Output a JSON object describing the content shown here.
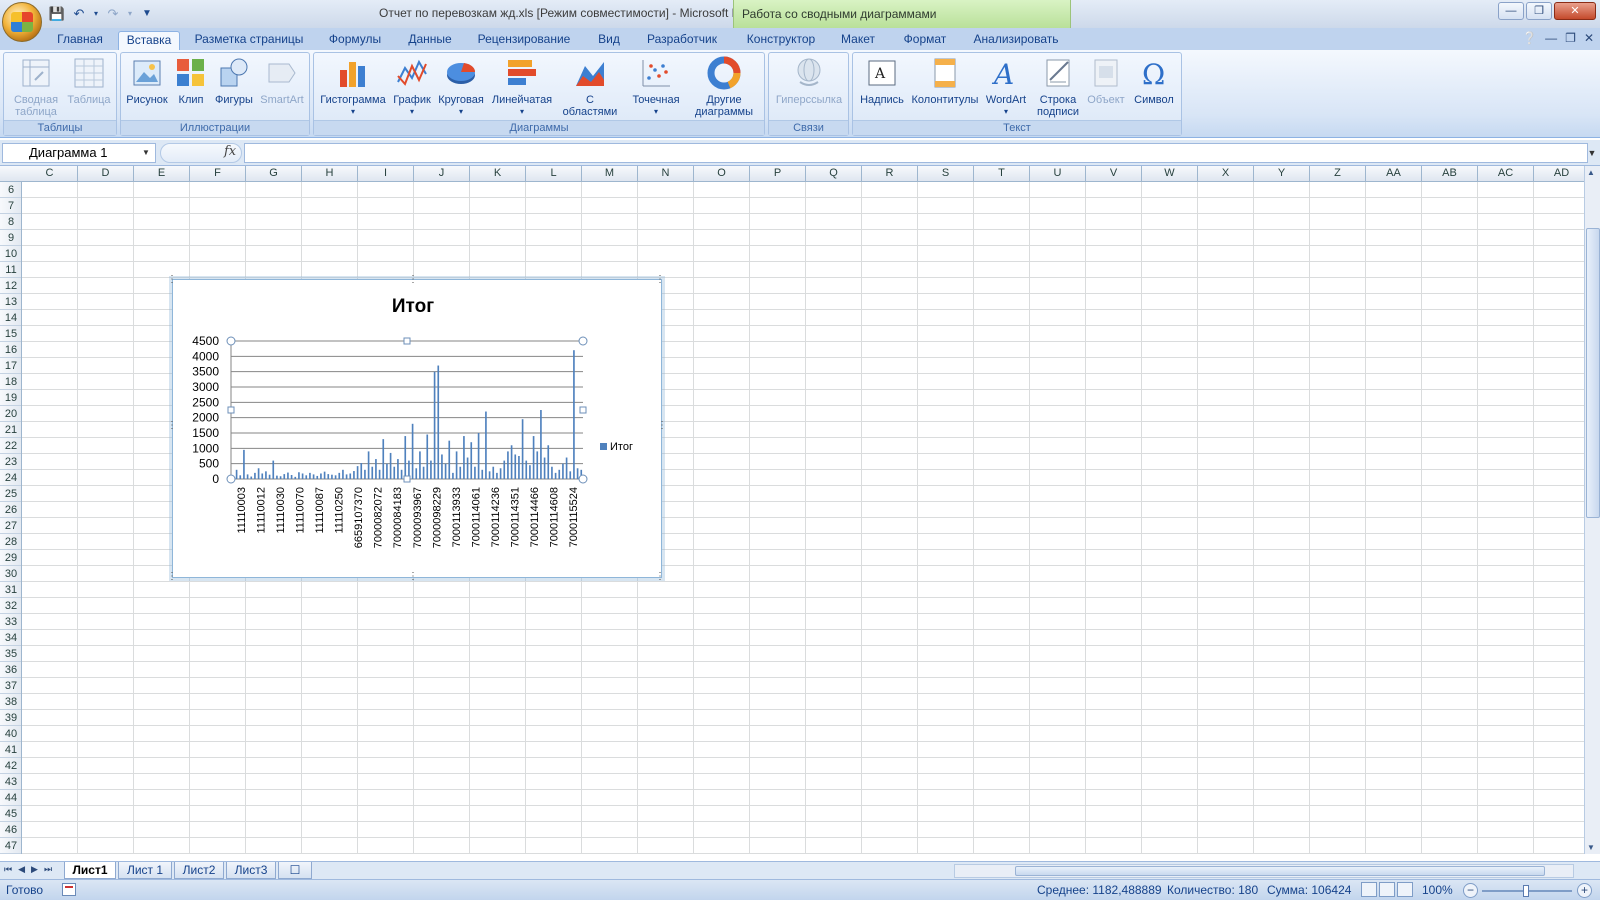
{
  "titlebar": {
    "window_title": "Отчет по перевозкам жд.xls  [Режим совместимости] - Microsoft Excel",
    "contextual_title": "Работа со сводными диаграммами"
  },
  "tabs": [
    {
      "label": "Главная"
    },
    {
      "label": "Вставка",
      "active": true
    },
    {
      "label": "Разметка страницы"
    },
    {
      "label": "Формулы"
    },
    {
      "label": "Данные"
    },
    {
      "label": "Рецензирование"
    },
    {
      "label": "Вид"
    },
    {
      "label": "Разработчик"
    },
    {
      "label": "Конструктор"
    },
    {
      "label": "Макет"
    },
    {
      "label": "Формат"
    },
    {
      "label": "Анализировать"
    }
  ],
  "ribbon": {
    "groups": {
      "tables": "Таблицы",
      "illustrations": "Иллюстрации",
      "charts": "Диаграммы",
      "links": "Связи",
      "text": "Текст"
    },
    "buttons": {
      "pivot_table_1": "Сводная",
      "pivot_table_2": "таблица",
      "table": "Таблица",
      "picture": "Рисунок",
      "clip": "Клип",
      "shapes": "Фигуры",
      "smartart": "SmartArt",
      "histogram": "Гистограмма",
      "line": "График",
      "pie": "Круговая",
      "bar": "Линейчатая",
      "area_1": "С",
      "area_2": "областями",
      "scatter": "Точечная",
      "other_1": "Другие",
      "other_2": "диаграммы",
      "hyperlink": "Гиперссылка",
      "textbox": "Надпись",
      "header_footer": "Колонтитулы",
      "wordart": "WordArt",
      "signature_1": "Строка",
      "signature_2": "подписи",
      "object": "Объект",
      "symbol": "Символ"
    }
  },
  "formula_bar": {
    "name_box": "Диаграмма 1",
    "fx": "fx",
    "value": ""
  },
  "grid": {
    "columns": [
      "C",
      "D",
      "E",
      "F",
      "G",
      "H",
      "I",
      "J",
      "K",
      "L",
      "M",
      "N",
      "O",
      "P",
      "Q",
      "R",
      "S",
      "T",
      "U",
      "V",
      "W",
      "X",
      "Y",
      "Z",
      "AA",
      "AB",
      "AC",
      "AD"
    ],
    "rows": [
      "6",
      "7",
      "8",
      "9",
      "10",
      "11",
      "12",
      "13",
      "14",
      "15",
      "16",
      "17",
      "18",
      "19",
      "20",
      "21",
      "22",
      "23",
      "24",
      "25",
      "26",
      "27",
      "28",
      "29",
      "30",
      "31",
      "32",
      "33",
      "34",
      "35",
      "36",
      "37",
      "38",
      "39",
      "40",
      "41",
      "42",
      "43",
      "44",
      "45",
      "46",
      "47"
    ]
  },
  "chart_data": {
    "type": "bar",
    "title": "Итог",
    "legend": {
      "entry": "Итог",
      "position": "right"
    },
    "color": "#4f81bd",
    "ylim": [
      0,
      4500
    ],
    "yticks": [
      0,
      500,
      1000,
      1500,
      2000,
      2500,
      3000,
      3500,
      4000,
      4500
    ],
    "xtick_labels": [
      "11110003",
      "11110012",
      "11110030",
      "11110070",
      "11110087",
      "11110250",
      "6659107370",
      "7000082072",
      "7000084183",
      "7000093967",
      "7000098229",
      "7000113933",
      "7000114061",
      "7000114236",
      "7000114351",
      "7000114466",
      "7000114608",
      "7000115524"
    ],
    "series": [
      {
        "name": "Итог",
        "values": [
          100,
          300,
          120,
          950,
          150,
          80,
          200,
          350,
          180,
          250,
          140,
          600,
          110,
          90,
          160,
          210,
          130,
          70,
          220,
          180,
          120,
          200,
          150,
          100,
          180,
          240,
          160,
          140,
          120,
          200,
          300,
          150,
          180,
          260,
          420,
          520,
          300,
          900,
          400,
          650,
          300,
          1300,
          500,
          850,
          400,
          650,
          300,
          1400,
          600,
          1800,
          350,
          900,
          400,
          1450,
          600,
          3500,
          3700,
          800,
          500,
          1250,
          200,
          900,
          400,
          1400,
          700,
          1200,
          400,
          1500,
          300,
          2200,
          250,
          400,
          200,
          350,
          600,
          900,
          1100,
          800,
          750,
          1950,
          600,
          450,
          1400,
          900,
          2250,
          700,
          1100,
          400,
          200,
          300,
          500,
          700,
          250,
          4200,
          350,
          300
        ]
      }
    ]
  },
  "sheets": [
    {
      "label": "Лист1",
      "active": true
    },
    {
      "label": "Лист 1"
    },
    {
      "label": "Лист2"
    },
    {
      "label": "Лист3"
    }
  ],
  "statusbar": {
    "ready": "Готово",
    "average": "Среднее: 1182,488889",
    "count": "Количество: 180",
    "sum": "Сумма: 106424",
    "zoom": "100%"
  }
}
